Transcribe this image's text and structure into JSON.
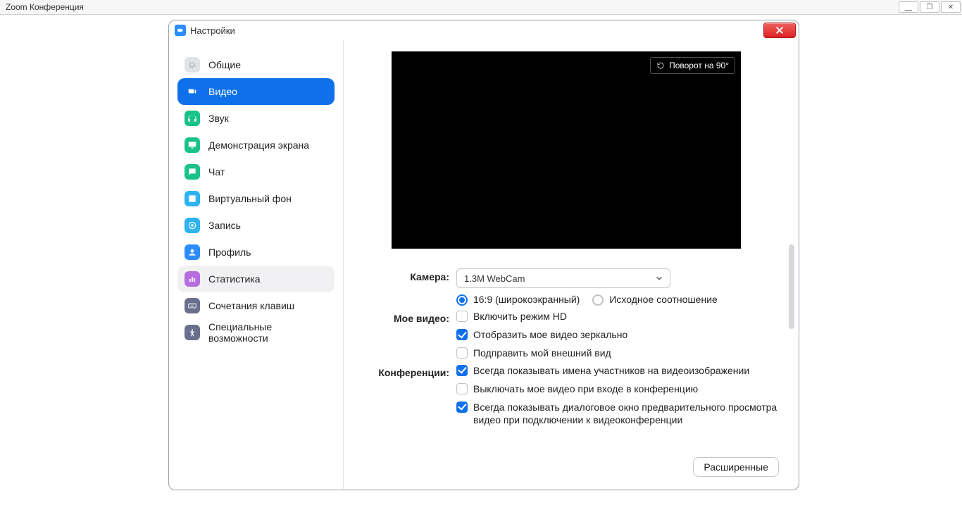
{
  "outer_window": {
    "title": "Zoom Конференция",
    "buttons": {
      "min": "—",
      "max": "◻",
      "close": "✕"
    }
  },
  "dialog": {
    "title": "Настройки",
    "close_label": "Close"
  },
  "sidebar": {
    "items": [
      {
        "label": "Общие",
        "icon_bg": "#e0e2e6"
      },
      {
        "label": "Видео",
        "icon_bg": "#ffffff"
      },
      {
        "label": "Звук",
        "icon_bg": "#19c28a"
      },
      {
        "label": "Демонстрация экрана",
        "icon_bg": "#19c28a"
      },
      {
        "label": "Чат",
        "icon_bg": "#19c28a"
      },
      {
        "label": "Виртуальный фон",
        "icon_bg": "#2db4f0"
      },
      {
        "label": "Запись",
        "icon_bg": "#2db4f0"
      },
      {
        "label": "Профиль",
        "icon_bg": "#2d8cff"
      },
      {
        "label": "Статистика",
        "icon_bg": "#b66dde"
      },
      {
        "label": "Сочетания клавиш",
        "icon_bg": "#6a6f8d"
      },
      {
        "label": "Специальные возможности",
        "icon_bg": "#6a6f8d"
      }
    ],
    "active_index": 1,
    "hover_index": 8
  },
  "video": {
    "rotate_label": "Поворот на 90°",
    "camera_label": "Камера:",
    "camera_value": "1.3M WebCam",
    "aspect": {
      "wide": "16:9 (широкоэкранный)",
      "orig": "Исходное соотношение",
      "selected": "wide"
    },
    "myvideo_label": "Мое видео:",
    "myvideo_opts": {
      "hd": {
        "label": "Включить режим HD",
        "checked": false
      },
      "mirror": {
        "label": "Отобразить мое видео зеркально",
        "checked": true
      },
      "touchup": {
        "label": "Подправить мой внешний вид",
        "checked": false
      }
    },
    "meetings_label": "Конференции:",
    "meetings_opts": {
      "names": {
        "label": "Всегда показывать имена участников на видеоизображении",
        "checked": true
      },
      "muteent": {
        "label": "Выключать мое видео при входе в конференцию",
        "checked": false
      },
      "preview": {
        "label": "Всегда показывать диалоговое окно предварительного просмотра видео при подключении к видеоконференции",
        "checked": true
      }
    },
    "advanced_label": "Расширенные"
  }
}
